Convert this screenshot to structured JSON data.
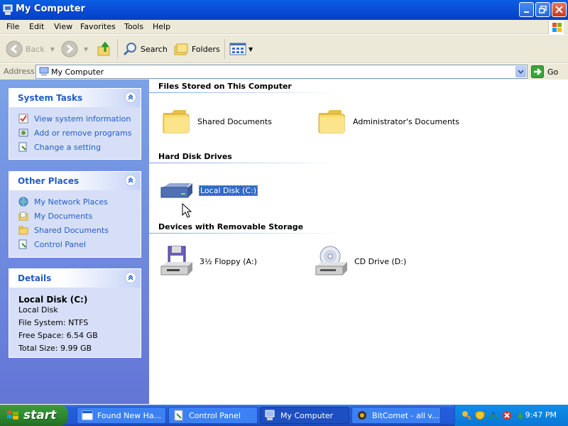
{
  "window": {
    "title": "My Computer"
  },
  "menu": [
    "File",
    "Edit",
    "View",
    "Favorites",
    "Tools",
    "Help"
  ],
  "toolbar": {
    "back": "Back",
    "search": "Search",
    "folders": "Folders"
  },
  "address": {
    "label": "Address",
    "value": "My Computer",
    "go": "Go"
  },
  "system_tasks": {
    "title": "System Tasks",
    "items": [
      "View system information",
      "Add or remove programs",
      "Change a setting"
    ]
  },
  "other_places": {
    "title": "Other Places",
    "items": [
      "My Network Places",
      "My Documents",
      "Shared Documents",
      "Control Panel"
    ]
  },
  "details": {
    "title": "Details",
    "name": "Local Disk (C:)",
    "type": "Local Disk",
    "file_system": "File System: NTFS",
    "free_space": "Free Space: 6.54 GB",
    "total_size": "Total Size: 9.99 GB"
  },
  "groups": [
    {
      "title": "Files Stored on This Computer",
      "items": [
        "Shared Documents",
        "Administrator's Documents"
      ]
    },
    {
      "title": "Hard Disk Drives",
      "items": [
        "Local Disk (C:)"
      ]
    },
    {
      "title": "Devices with Removable Storage",
      "items": [
        "3½ Floppy (A:)",
        "CD Drive (D:)"
      ]
    }
  ],
  "taskbar": {
    "start": "start",
    "buttons": [
      "Found New Ha...",
      "Control Panel",
      "My Computer",
      "BitComet - all v..."
    ],
    "clock": "9:47 PM"
  },
  "colors": {
    "accent": "#215dc6",
    "selection": "#316ac5",
    "titlebar": "#0a4fd8",
    "start": "#2f8a2f"
  }
}
